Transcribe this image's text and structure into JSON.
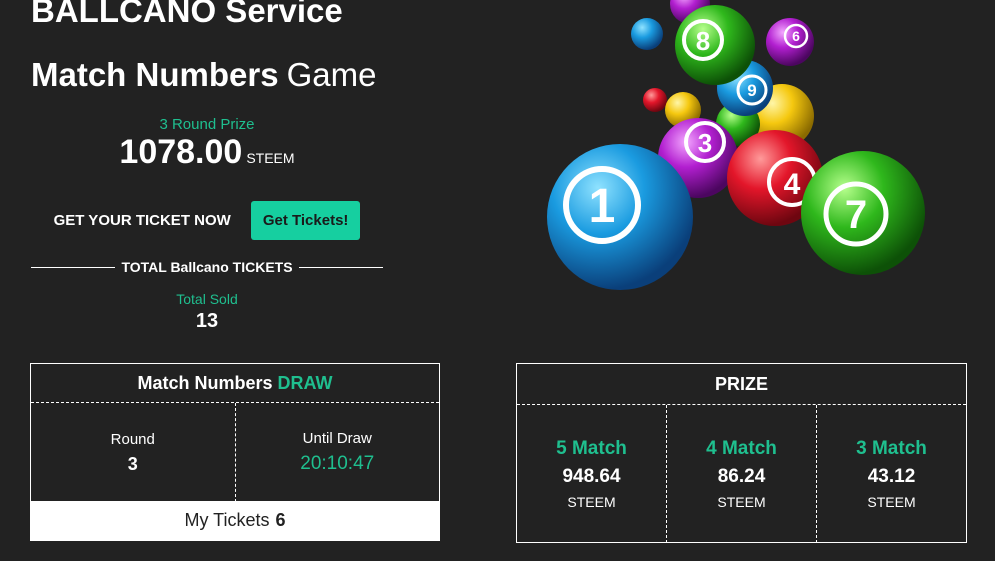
{
  "header": {
    "title_line1": "BALLCANO Service",
    "title_bold": "Match Numbers",
    "title_light": "Game"
  },
  "round_prize": {
    "label": "3 Round Prize",
    "value": "1078.00",
    "unit": "STEEM"
  },
  "tickets": {
    "cta_text": "GET YOUR TICKET NOW",
    "button_label": "Get Tickets!"
  },
  "totals": {
    "heading": "TOTAL Ballcano TICKETS",
    "sold_label": "Total Sold",
    "sold_value": "13"
  },
  "draw": {
    "title": "Match Numbers",
    "title_accent": "DRAW",
    "round_label": "Round",
    "round_value": "3",
    "until_label": "Until Draw",
    "until_value": "20:10:47",
    "my_tickets_label": "My Tickets",
    "my_tickets_value": "6"
  },
  "prize": {
    "title": "PRIZE",
    "tiers": [
      {
        "match": "5 Match",
        "amount": "948.64",
        "unit": "STEEM"
      },
      {
        "match": "4 Match",
        "amount": "86.24",
        "unit": "STEEM"
      },
      {
        "match": "3 Match",
        "amount": "43.12",
        "unit": "STEEM"
      }
    ]
  },
  "illustration": {
    "ball_numbers": [
      "1",
      "4",
      "7",
      "3",
      "8",
      "9",
      "6"
    ],
    "colors": {
      "accent": "#1fbf8f",
      "button": "#16cfa0",
      "background": "#222222"
    }
  }
}
